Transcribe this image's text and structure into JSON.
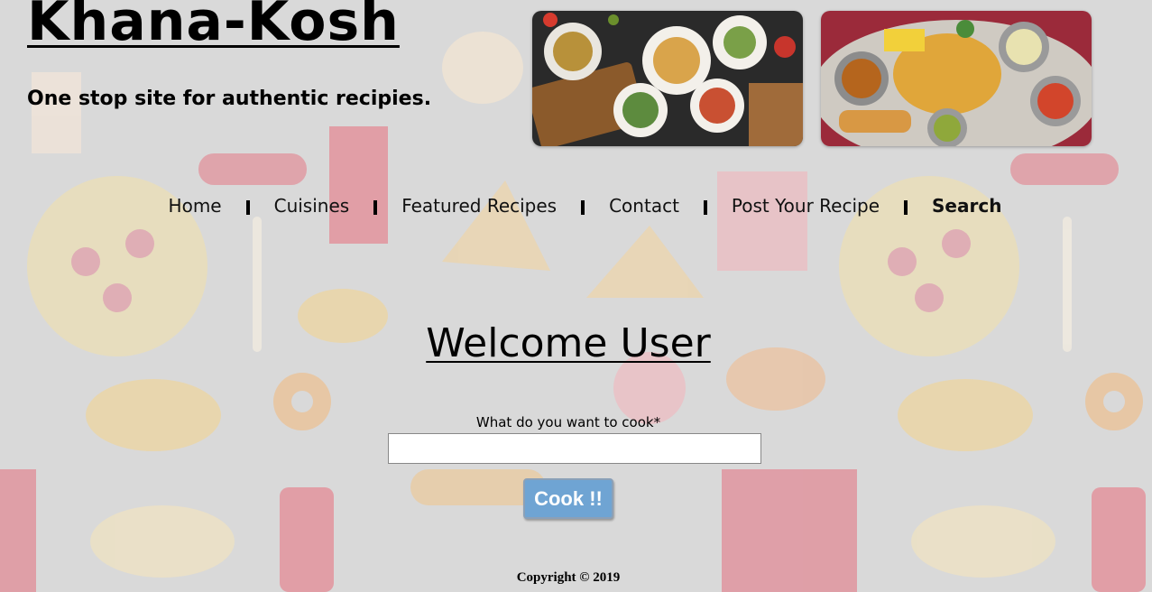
{
  "header": {
    "site_title": "Khana-Kosh",
    "tagline": "One stop site for authentic recipies."
  },
  "nav": {
    "items": [
      {
        "label": "Home"
      },
      {
        "label": "Cuisines"
      },
      {
        "label": "Featured Recipes"
      },
      {
        "label": "Contact"
      },
      {
        "label": "Post Your Recipe"
      },
      {
        "label": "Search"
      }
    ]
  },
  "main": {
    "welcome": "Welcome User",
    "search_label": "What do you want to cook*",
    "search_value": "",
    "cook_button": "Cook !!"
  },
  "footer": {
    "copyright": "Copyright © 2019"
  },
  "colors": {
    "background": "#d9d9d9",
    "button": "#6fa4d3",
    "text": "#000000"
  }
}
